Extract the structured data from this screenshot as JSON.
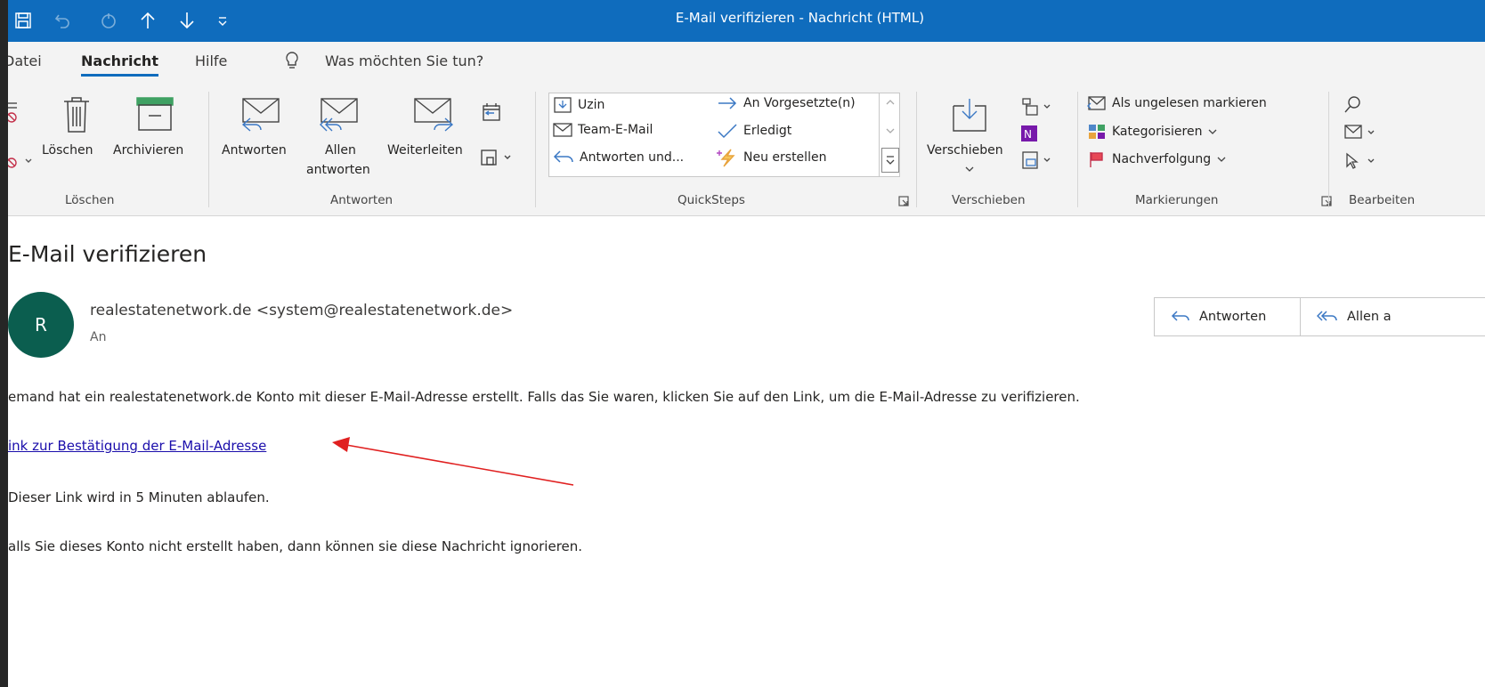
{
  "window": {
    "title": "E-Mail verifizieren  -  Nachricht (HTML)"
  },
  "menu": {
    "tabs": [
      {
        "label": "Datei"
      },
      {
        "label": "Nachricht"
      },
      {
        "label": "Hilfe"
      }
    ],
    "search_placeholder": "Was möchten Sie tun?"
  },
  "ribbon": {
    "loeschen": {
      "label": "Löschen",
      "delete_label": "Löschen",
      "archive_label": "Archivieren"
    },
    "antworten": {
      "label": "Antworten",
      "reply_label": "Antworten",
      "reply_all_line1": "Allen",
      "reply_all_line2": "antworten",
      "forward_label": "Weiterleiten"
    },
    "quicksteps": {
      "label": "QuickSteps",
      "items": [
        {
          "label": "Uzin"
        },
        {
          "label": "An Vorgesetzte(n)"
        },
        {
          "label": "Team-E-Mail"
        },
        {
          "label": "Erledigt"
        },
        {
          "label": "Antworten und..."
        },
        {
          "label": "Neu erstellen"
        }
      ]
    },
    "verschieben": {
      "label": "Verschieben",
      "move_label": "Verschieben"
    },
    "markierungen": {
      "label": "Markierungen",
      "mark_unread": "Als ungelesen markieren",
      "categorize": "Kategorisieren",
      "followup": "Nachverfolgung"
    },
    "bearbeiten": {
      "label": "Bearbeiten"
    }
  },
  "message": {
    "subject": "E-Mail verifizieren",
    "avatar_initial": "R",
    "sender": "realestatenetwork.de <system@realestatenetwork.de>",
    "recipient_label": "An",
    "actions": {
      "reply": "Antworten",
      "reply_all": "Allen a"
    },
    "body": {
      "p1": "emand hat ein realestatenetwork.de Konto mit dieser E-Mail-Adresse erstellt. Falls das Sie waren, klicken Sie auf den Link, um die E-Mail-Adresse zu verifizieren.",
      "link": "ink zur Bestätigung der E-Mail-Adresse",
      "p2": "Dieser Link wird in 5 Minuten ablaufen.",
      "p3": "alls Sie dieses Konto nicht erstellt haben, dann können sie diese Nachricht ignorieren."
    }
  },
  "colors": {
    "titlebar": "#0f6cbd",
    "avatar": "#0b5e4f",
    "link": "#1a0dab",
    "annotation_arrow": "#e02020"
  }
}
